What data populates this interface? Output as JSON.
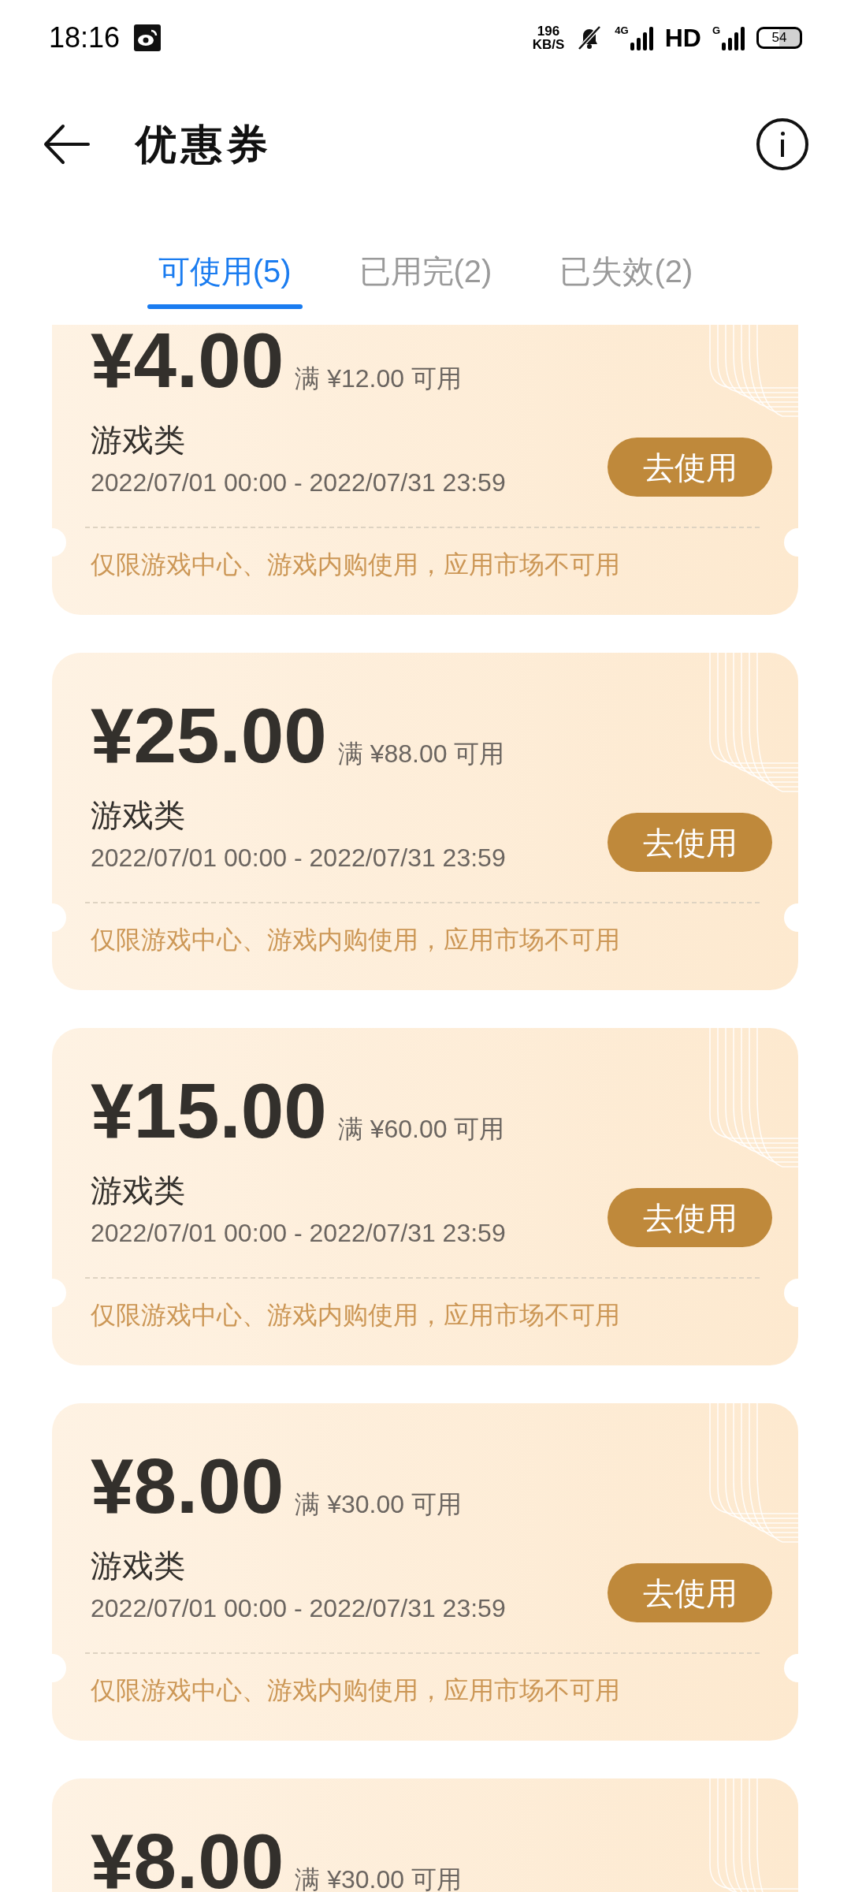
{
  "status_bar": {
    "time": "18:16",
    "net_speed_value": "196",
    "net_speed_unit": "KB/S",
    "network": "4G",
    "hd": "HD",
    "network_2": "G",
    "battery": "54"
  },
  "header": {
    "title": "优惠券"
  },
  "tabs": [
    {
      "label": "可使用(5)",
      "selected": true
    },
    {
      "label": "已用完(2)",
      "selected": false
    },
    {
      "label": "已失效(2)",
      "selected": false
    }
  ],
  "coupons": [
    {
      "amount": "¥4.00",
      "condition": "满 ¥12.00 可用",
      "category": "游戏类",
      "validity": "2022/07/01 00:00 - 2022/07/31 23:59",
      "button": "去使用",
      "note": "仅限游戏中心、游戏内购使用，应用市场不可用"
    },
    {
      "amount": "¥25.00",
      "condition": "满 ¥88.00 可用",
      "category": "游戏类",
      "validity": "2022/07/01 00:00 - 2022/07/31 23:59",
      "button": "去使用",
      "note": "仅限游戏中心、游戏内购使用，应用市场不可用"
    },
    {
      "amount": "¥15.00",
      "condition": "满 ¥60.00 可用",
      "category": "游戏类",
      "validity": "2022/07/01 00:00 - 2022/07/31 23:59",
      "button": "去使用",
      "note": "仅限游戏中心、游戏内购使用，应用市场不可用"
    },
    {
      "amount": "¥8.00",
      "condition": "满 ¥30.00 可用",
      "category": "游戏类",
      "validity": "2022/07/01 00:00 - 2022/07/31 23:59",
      "button": "去使用",
      "note": "仅限游戏中心、游戏内购使用，应用市场不可用"
    },
    {
      "amount": "¥8.00",
      "condition": "满 ¥30.00 可用"
    }
  ]
}
